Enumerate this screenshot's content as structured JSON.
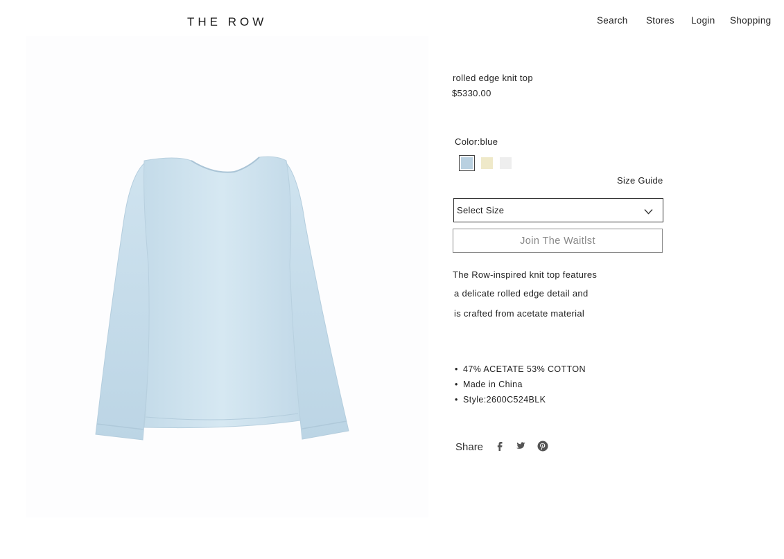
{
  "header": {
    "logo": "THE ROW",
    "nav": {
      "search": "Search",
      "stores": "Stores",
      "login": "Login",
      "shopping": "Shopping"
    }
  },
  "product": {
    "name": "rolled edge knit top",
    "price": "$5330.00",
    "image_icon": "blue-long-sleeve-top-photo",
    "color_label": "Color:",
    "color_value": "blue",
    "swatches": [
      {
        "name": "blue",
        "color": "#b9d0e0",
        "selected": true
      },
      {
        "name": "cream",
        "color": "#efe9c9",
        "selected": false
      },
      {
        "name": "white",
        "color": "#eeeeee",
        "selected": false
      }
    ],
    "size_guide": "Size Guide",
    "size_select": {
      "label": "Select Size",
      "icon": "chevron-down-icon"
    },
    "waitlist_button": "Join  The Waitlst",
    "description": [
      "The Row-inspired knit top features",
      "a delicate rolled edge detail and",
      "is crafted from acetate material"
    ],
    "details": [
      "47% ACETATE 53% COTTON",
      "Made in China",
      "Style:2600C524BLK"
    ],
    "details_bullet": "•",
    "share": {
      "label": "Share",
      "icons": [
        "facebook-icon",
        "twitter-icon",
        "pinterest-icon"
      ]
    }
  },
  "colors": {
    "text": "#222222",
    "top_blue": "#cfe2ee",
    "button_border": "#8a8a8a"
  }
}
